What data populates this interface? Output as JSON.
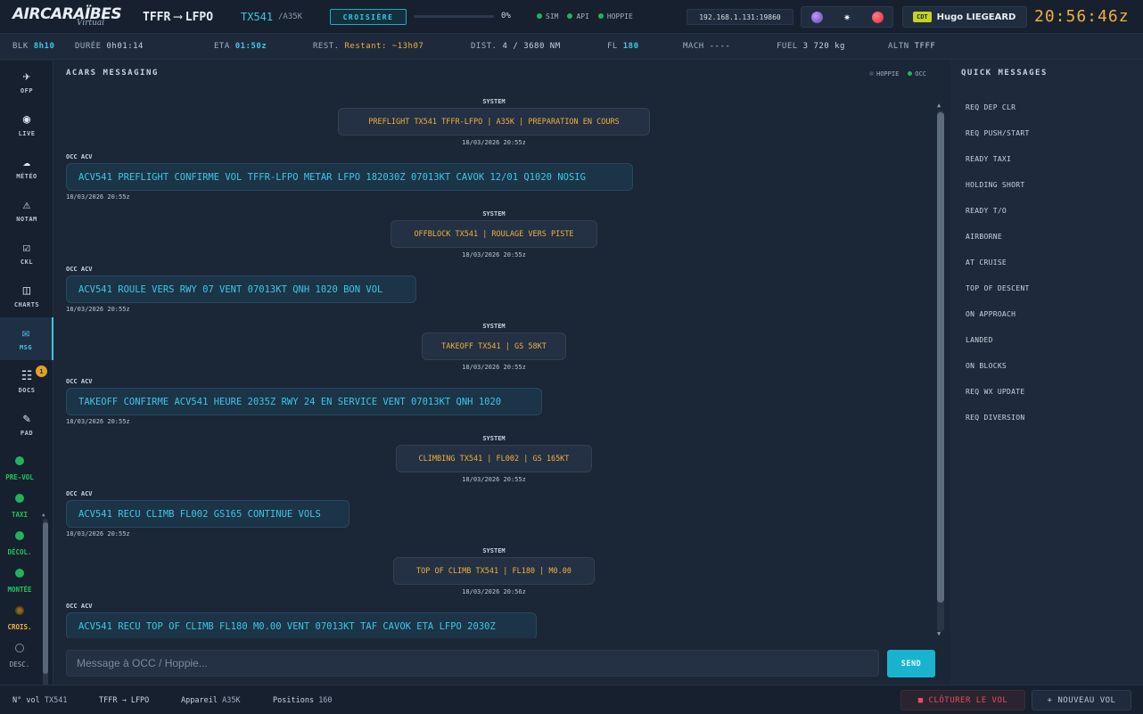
{
  "header": {
    "brand": "AIRCARAÏBES",
    "brand_sub": "Virtual",
    "origin": "TFFR",
    "destination": "LFPO",
    "flight_number": "TX541",
    "aircraft_type": "/A35K",
    "phase": "CROISIÈRE",
    "progress_percent": 0,
    "progress_label": "0%",
    "links": [
      {
        "label": "SIM",
        "color": "#21b35c"
      },
      {
        "label": "API",
        "color": "#21b35c"
      },
      {
        "label": "HOPPIE",
        "color": "#21b35c"
      }
    ],
    "ip_address": "192.168.1.131:19860",
    "icons": [
      "purple-orb-icon",
      "sun-icon",
      "red-record-icon"
    ],
    "user_role": "CDT",
    "user_name": "Hugo LIEGEARD",
    "clock": "20:56:46z"
  },
  "infobar": {
    "blk_label": "BLK",
    "blk_value": "8h10",
    "duree_label": "DURÉE",
    "duree_value": "0h01:14",
    "eta_label": "ETA",
    "eta_value": "01:50z",
    "rest_label": "REST.",
    "rest_value": "Restant: ~13h07",
    "dist_label": "DIST.",
    "dist_value": "4 / 3680 NM",
    "fl_label": "FL",
    "fl_value": "180",
    "mach_label": "MACH",
    "mach_value": "----",
    "fuel_label": "FUEL",
    "fuel_value": "3 720 kg",
    "altn_label": "ALTN",
    "altn_value": "TFFF"
  },
  "sidebar": {
    "nav": [
      {
        "label": "OFP",
        "glyph": "✈",
        "icon": "plane-icon"
      },
      {
        "label": "LIVE",
        "glyph": "◉",
        "icon": "live-icon"
      },
      {
        "label": "MÉTÉO",
        "glyph": "☁",
        "icon": "cloud-icon"
      },
      {
        "label": "NOTAM",
        "glyph": "⚠",
        "icon": "warning-icon"
      },
      {
        "label": "CKL",
        "glyph": "☑",
        "icon": "checklist-icon"
      },
      {
        "label": "CHARTS",
        "glyph": "◫",
        "icon": "chart-icon"
      },
      {
        "label": "MSG",
        "glyph": "✉",
        "icon": "mail-icon"
      },
      {
        "label": "DOCS",
        "glyph": "☷",
        "icon": "docs-icon",
        "badge": "1"
      },
      {
        "label": "PAD",
        "glyph": "✎",
        "icon": "pencil-icon"
      }
    ],
    "phases": [
      {
        "label": "PRE-VOL",
        "state": "done"
      },
      {
        "label": "TAXI",
        "state": "done"
      },
      {
        "label": "DÉCOL.",
        "state": "done"
      },
      {
        "label": "MONTÉE",
        "state": "done"
      },
      {
        "label": "CROIS.",
        "state": "current"
      },
      {
        "label": "DESC.",
        "state": "todo"
      }
    ]
  },
  "messaging": {
    "title": "ACARS MESSAGING",
    "legend": [
      {
        "label": "HOPPIE",
        "color": "#3a4a60"
      },
      {
        "label": "OCC",
        "color": "#21b35c"
      }
    ],
    "messages": [
      {
        "type": "system",
        "sender": "SYSTEM",
        "text": "PREFLIGHT TX541 TFFR-LFPO | A35K | PREPARATION EN COURS",
        "time": "18/03/2026 20:55z"
      },
      {
        "type": "occ",
        "sender": "OCC ACV",
        "text": "ACV541 PREFLIGHT CONFIRME VOL TFFR-LFPO METAR LFPO 182030Z 07013KT CAVOK 12/01 Q1020 NOSIG",
        "time": "18/03/2026 20:55z"
      },
      {
        "type": "system",
        "sender": "SYSTEM",
        "text": "OFFBLOCK TX541 | ROULAGE VERS PISTE",
        "time": "18/03/2026 20:55z"
      },
      {
        "type": "occ",
        "sender": "OCC ACV",
        "text": "ACV541 ROULE VERS RWY 07 VENT 07013KT QNH 1020 BON VOL",
        "time": "18/03/2026 20:55z"
      },
      {
        "type": "system",
        "sender": "SYSTEM",
        "text": "TAKEOFF TX541 | GS 58KT",
        "time": "18/03/2026 20:55z"
      },
      {
        "type": "occ",
        "sender": "OCC ACV",
        "text": "TAKEOFF CONFIRME ACV541 HEURE 2035Z RWY 24 EN SERVICE VENT 07013KT QNH 1020",
        "time": "18/03/2026 20:55z"
      },
      {
        "type": "system",
        "sender": "SYSTEM",
        "text": "CLIMBING TX541 | FL002 | GS 165KT",
        "time": "18/03/2026 20:55z"
      },
      {
        "type": "occ",
        "sender": "OCC ACV",
        "text": "ACV541 RECU CLIMB FL002 GS165 CONTINUE VOLS",
        "time": "18/03/2026 20:55z"
      },
      {
        "type": "system",
        "sender": "SYSTEM",
        "text": "TOP OF CLIMB TX541 | FL180 | M0.00",
        "time": "18/03/2026 20:56z"
      },
      {
        "type": "occ",
        "sender": "OCC ACV",
        "text": "ACV541 RECU TOP OF CLIMB FL180 M0.00 VENT 07013KT TAF CAVOK ETA LFPO 2030Z",
        "time": ""
      }
    ],
    "input_placeholder": "Message à OCC / Hoppie...",
    "input_value": "",
    "send_label": "SEND"
  },
  "quick_messages": {
    "title": "QUICK MESSAGES",
    "items": [
      "REQ DEP CLR",
      "REQ PUSH/START",
      "READY TAXI",
      "HOLDING SHORT",
      "READY T/O",
      "AIRBORNE",
      "AT CRUISE",
      "TOP OF DESCENT",
      "ON APPROACH",
      "LANDED",
      "ON BLOCKS",
      "REQ WX UPDATE",
      "REQ DIVERSION"
    ]
  },
  "footer": {
    "vol_label": "N° vol",
    "vol_value": "TX541",
    "route": "TFFR → LFPO",
    "appareil_label": "Appareil",
    "appareil_value": "A35K",
    "positions_label": "Positions",
    "positions_value": "160",
    "close_label": "■ CLÔTURER LE VOL",
    "new_label": "+ NOUVEAU VOL"
  },
  "colors": {
    "accent": "#3ec7e6",
    "amber": "#f0b13a",
    "ok": "#21b35c",
    "danger": "#e0505c"
  }
}
